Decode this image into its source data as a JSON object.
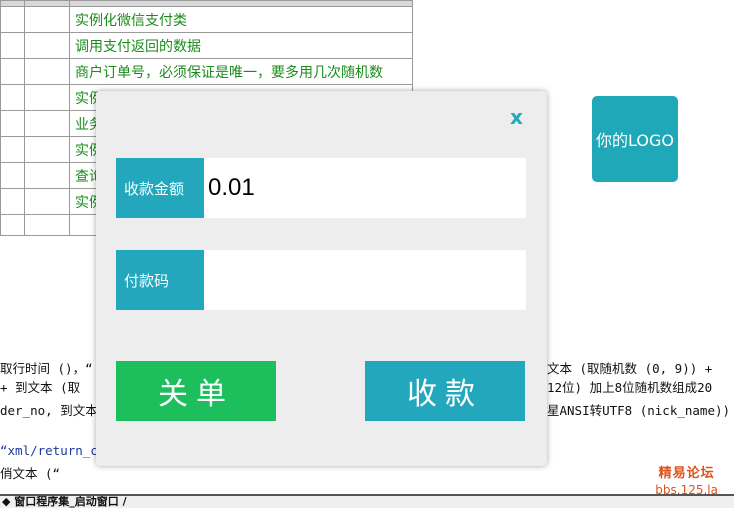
{
  "table": {
    "rows": [
      "实例化微信支付类",
      "调用支付返回的数据",
      "商户订单号，必须保证是唯一，要多用几次随机数",
      "实例",
      "业务",
      "实例",
      "查询",
      "实例",
      ""
    ]
  },
  "logo": {
    "text": "你的LOGO"
  },
  "code": {
    "line1_left": "取行时间 ()，“",
    "line1_right": "文本 (取随机数 (0, 9)) +",
    "line2_left": " + 到文本 (取",
    "line2_right": "12位) 加上8位随机数组成20",
    "line3_left": "der_no, 到文本",
    "line3_right": "星ANSI转UTF8 (nick_name))",
    "line4_left": "“xml/return_c",
    "line5_left": "俏文本 (“"
  },
  "bottom_bar": {
    "text": "◆ 窗口程序集_启动窗口 /"
  },
  "watermark": {
    "line1": "精易论坛",
    "line2": "bbs.125.la"
  },
  "dialog": {
    "close_label": "x",
    "amount": {
      "label": "收款金额",
      "value": "0.01"
    },
    "paycode": {
      "label": "付款码",
      "value": ""
    },
    "buttons": {
      "close_order": "关单",
      "collect": "收款"
    }
  },
  "colors": {
    "accent": "#22a7bd",
    "green": "#1dbf5c",
    "watermark": "#e0521a"
  }
}
